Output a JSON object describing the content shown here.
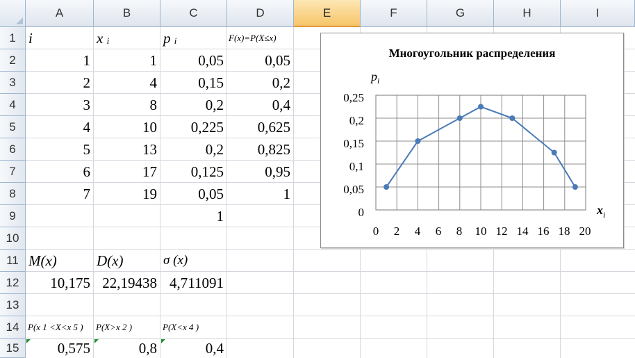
{
  "columns": [
    "A",
    "B",
    "C",
    "D",
    "E",
    "F",
    "G",
    "H",
    "I"
  ],
  "rows": [
    "1",
    "2",
    "3",
    "4",
    "5",
    "6",
    "7",
    "8",
    "9",
    "10",
    "11",
    "12",
    "13",
    "14",
    "15"
  ],
  "cells": {
    "A1": "i",
    "B1": "x",
    "B1_sub": "i",
    "C1": "p",
    "C1_sub": "i",
    "D1": "F(x)=P(X≤x)",
    "A2": "1",
    "B2": "1",
    "C2": "0,05",
    "D2": "0,05",
    "A3": "2",
    "B3": "4",
    "C3": "0,15",
    "D3": "0,2",
    "A4": "3",
    "B4": "8",
    "C4": "0,2",
    "D4": "0,4",
    "A5": "4",
    "B5": "10",
    "C5": "0,225",
    "D5": "0,625",
    "A6": "5",
    "B6": "13",
    "C6": "0,2",
    "D6": "0,825",
    "A7": "6",
    "B7": "17",
    "C7": "0,125",
    "D7": "0,95",
    "A8": "7",
    "B8": "19",
    "C8": "0,05",
    "D8": "1",
    "C9": "1",
    "A11": "M(x)",
    "B11": "D(x)",
    "C11": "σ (x)",
    "A12": "10,175",
    "B12": "22,19438",
    "C12": "4,711091",
    "A14": "P(x 1 <X<x 5 )",
    "B14": "P(X>x 2 )",
    "C14": "P(X<x 4 )",
    "A15": "0,575",
    "B15": "0,8",
    "C15": "0,4"
  },
  "chart": {
    "title": "Многоугольник распределения",
    "ylabel": "p",
    "ylabel_sub": "i",
    "xlabel": "x",
    "xlabel_sub": "i",
    "y_ticks": [
      "0,25",
      "0,2",
      "0,15",
      "0,1",
      "0,05",
      "0"
    ],
    "x_ticks": [
      "0",
      "2",
      "4",
      "6",
      "8",
      "10",
      "12",
      "14",
      "16",
      "18",
      "20"
    ],
    "line_color": "#4a7ab8"
  },
  "chart_data": {
    "type": "line",
    "title": "Многоугольник распределения",
    "xlabel": "xi",
    "ylabel": "pi",
    "x": [
      1,
      4,
      8,
      10,
      13,
      17,
      19
    ],
    "y": [
      0.05,
      0.15,
      0.2,
      0.225,
      0.2,
      0.125,
      0.05
    ],
    "xlim": [
      0,
      20
    ],
    "ylim": [
      0,
      0.25
    ],
    "grid": true
  }
}
